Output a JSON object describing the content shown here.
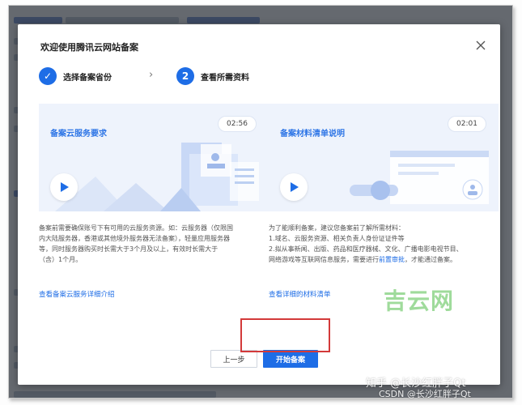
{
  "dialog": {
    "title": "欢迎使用腾讯云网站备案",
    "close_icon": "close-icon"
  },
  "steps": [
    {
      "index": "✓",
      "label": "选择备案省份",
      "state": "done"
    },
    {
      "index": "2",
      "label": "查看所需资料",
      "state": "active"
    }
  ],
  "step_separator": "›",
  "cards": [
    {
      "title": "备案云服务要求",
      "duration": "02:56",
      "description_lines": [
        "备案前需要确保账号下有可用的云服务资源。如：云服务器（仅限国",
        "内大陆服务器，香港或其他境外服务器无法备案），轻量应用服务器",
        "等，同时服务器购买时长需大于3个月及以上，有效时长需大于",
        "（含）1个月。"
      ],
      "link": "查看备案云服务详细介绍"
    },
    {
      "title": "备案材料清单说明",
      "duration": "02:01",
      "description_lines": [
        "为了能顺利备案，建议您备案前了解所需材料：",
        "1.域名、云服务资源、相关负责人身份证证件等",
        "2.拟从事新闻、出版、药品和医疗器械、文化、广播电影电视节目、",
        "网络游戏等互联网信息服务，需要进行"
      ],
      "description_link": "前置审批",
      "description_tail": "，才能通过备案。",
      "link": "查看详细的材料清单"
    }
  ],
  "buttons": {
    "prev": "上一步",
    "start": "开始备案"
  },
  "watermarks": {
    "site": "吉云网",
    "zhihu": "知乎 @长沙红胖子Qt",
    "csdn": "CSDN @长沙红胖子Qt"
  },
  "colors": {
    "primary": "#1e6de6",
    "highlight": "#d33a3a",
    "card_bg": "#eef3fc"
  }
}
